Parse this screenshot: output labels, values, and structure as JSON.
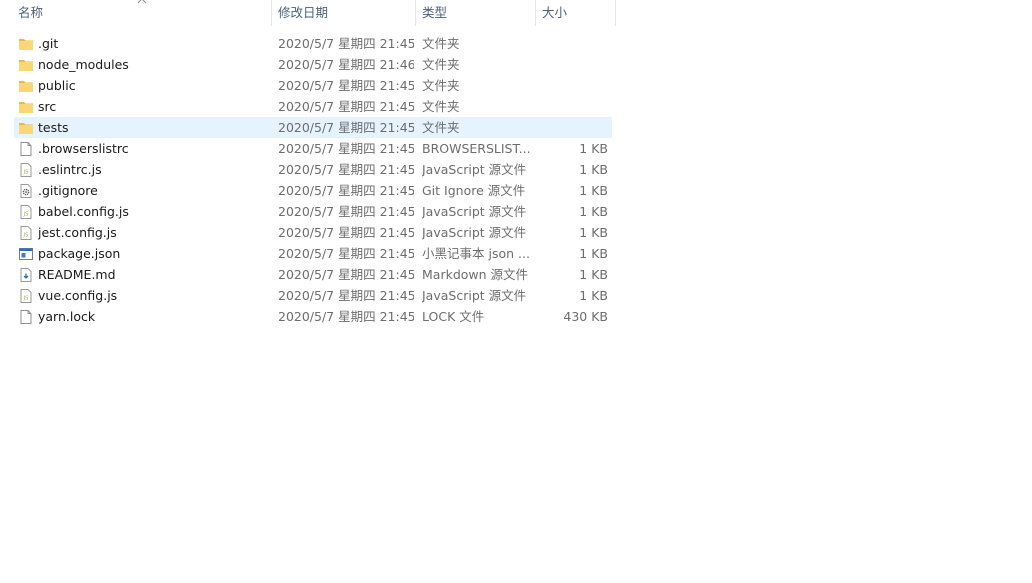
{
  "columns": {
    "name": "名称",
    "date": "修改日期",
    "type": "类型",
    "size": "大小"
  },
  "files": [
    {
      "name": ".git",
      "date": "2020/5/7 星期四 21:45",
      "type": "文件夹",
      "size": "",
      "icon": "folder-icon",
      "selected": false
    },
    {
      "name": "node_modules",
      "date": "2020/5/7 星期四 21:46",
      "type": "文件夹",
      "size": "",
      "icon": "folder-icon",
      "selected": false
    },
    {
      "name": "public",
      "date": "2020/5/7 星期四 21:45",
      "type": "文件夹",
      "size": "",
      "icon": "folder-icon",
      "selected": false
    },
    {
      "name": "src",
      "date": "2020/5/7 星期四 21:45",
      "type": "文件夹",
      "size": "",
      "icon": "folder-icon",
      "selected": false
    },
    {
      "name": "tests",
      "date": "2020/5/7 星期四 21:45",
      "type": "文件夹",
      "size": "",
      "icon": "folder-icon",
      "selected": true
    },
    {
      "name": ".browserslistrc",
      "date": "2020/5/7 星期四 21:45",
      "type": "BROWSERSLIST...",
      "size": "1 KB",
      "icon": "blank-file-icon",
      "selected": false
    },
    {
      "name": ".eslintrc.js",
      "date": "2020/5/7 星期四 21:45",
      "type": "JavaScript 源文件",
      "size": "1 KB",
      "icon": "js-file-icon",
      "selected": false
    },
    {
      "name": ".gitignore",
      "date": "2020/5/7 星期四 21:45",
      "type": "Git Ignore 源文件",
      "size": "1 KB",
      "icon": "gear-file-icon",
      "selected": false
    },
    {
      "name": "babel.config.js",
      "date": "2020/5/7 星期四 21:45",
      "type": "JavaScript 源文件",
      "size": "1 KB",
      "icon": "js-file-icon",
      "selected": false
    },
    {
      "name": "jest.config.js",
      "date": "2020/5/7 星期四 21:45",
      "type": "JavaScript 源文件",
      "size": "1 KB",
      "icon": "js-file-icon",
      "selected": false
    },
    {
      "name": "package.json",
      "date": "2020/5/7 星期四 21:45",
      "type": "小黑记事本 json ...",
      "size": "1 KB",
      "icon": "json-file-icon",
      "selected": false
    },
    {
      "name": "README.md",
      "date": "2020/5/7 星期四 21:45",
      "type": "Markdown 源文件",
      "size": "1 KB",
      "icon": "markdown-file-icon",
      "selected": false
    },
    {
      "name": "vue.config.js",
      "date": "2020/5/7 星期四 21:45",
      "type": "JavaScript 源文件",
      "size": "1 KB",
      "icon": "js-file-icon",
      "selected": false
    },
    {
      "name": "yarn.lock",
      "date": "2020/5/7 星期四 21:45",
      "type": "LOCK 文件",
      "size": "430 KB",
      "icon": "blank-file-icon",
      "selected": false
    }
  ],
  "colors": {
    "folder": "#f8d775",
    "folder_dark": "#e8b84a",
    "selected_row": "#e5f3ff",
    "header_text": "#4c607a"
  }
}
